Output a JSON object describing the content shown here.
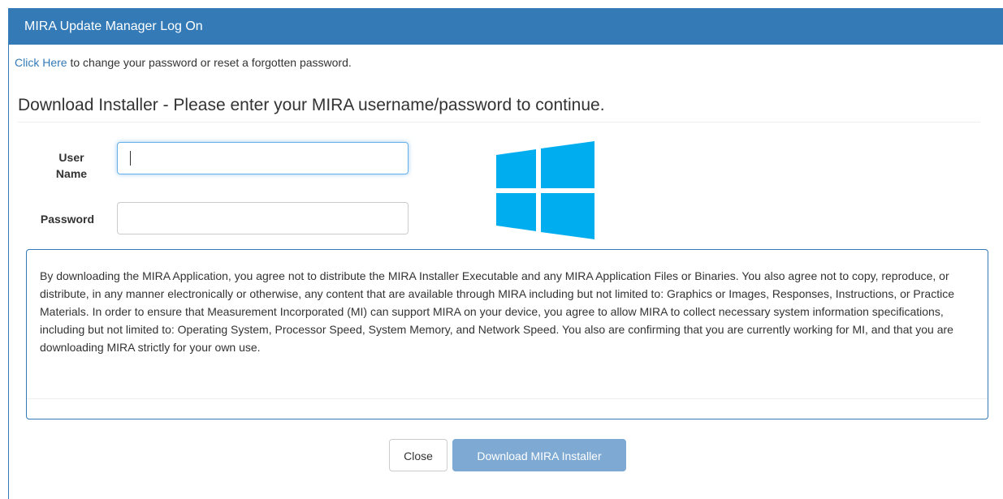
{
  "dialog": {
    "title": "MIRA Update Manager Log On"
  },
  "notice": {
    "link_text": "Click Here",
    "rest_text": " to change your password or reset a forgotten password."
  },
  "form": {
    "heading": "Download Installer - Please enter your MIRA username/password to continue.",
    "username_label": "User Name",
    "username_value": "",
    "password_label": "Password",
    "password_value": ""
  },
  "logo": {
    "icon": "windows-logo-icon",
    "color": "#00adef"
  },
  "agreement": {
    "text": "By downloading the MIRA Application, you agree not to distribute the MIRA Installer Executable and any MIRA Application Files or Binaries. You also agree not to copy, reproduce, or distribute, in any manner electronically or otherwise, any content that are available through MIRA including but not limited to: Graphics or Images, Responses, Instructions, or Practice Materials. In order to ensure that Measurement Incorporated (MI) can support MIRA on your device, you agree to allow MIRA to collect necessary system information specifications, including but not limited to: Operating System, Processor Speed, System Memory, and Network Speed. You also are confirming that you are currently working for MI, and that you are downloading MIRA strictly for your own use."
  },
  "buttons": {
    "close_label": "Close",
    "download_label": "Download MIRA Installer"
  },
  "colors": {
    "header_bg": "#337ab7",
    "link": "#337ab7",
    "download_button": "#7ea9d2"
  }
}
